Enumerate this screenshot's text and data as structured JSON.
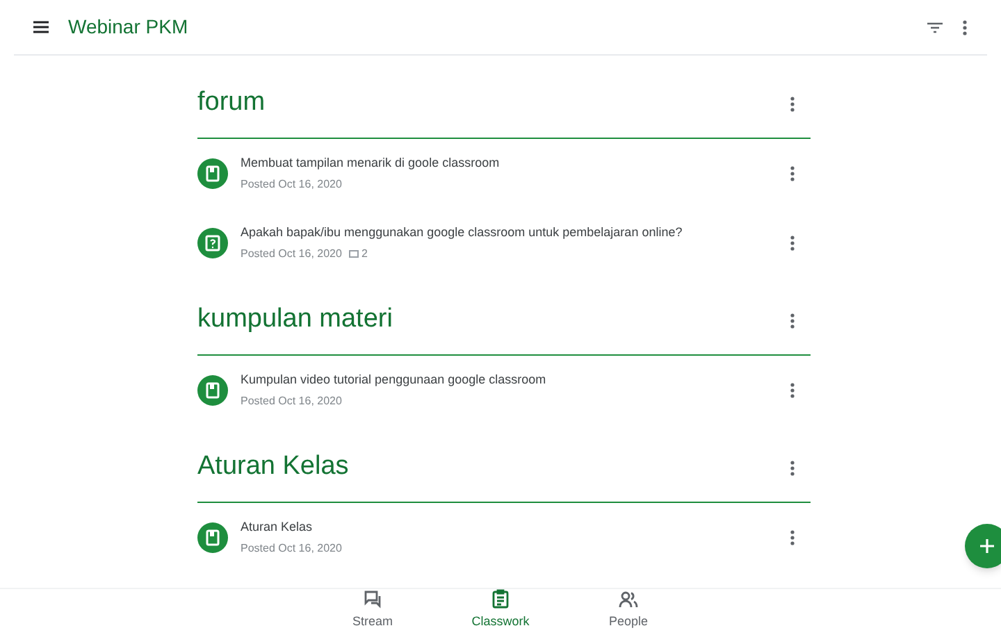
{
  "app_bar": {
    "title": "Webinar PKM"
  },
  "topics": [
    {
      "title": "forum",
      "items": [
        {
          "kind": "material",
          "title": "Membuat tampilan menarik di goole classroom",
          "posted": "Posted Oct 16, 2020"
        },
        {
          "kind": "question",
          "title": "Apakah bapak/ibu menggunakan google classroom untuk pembelajaran online?",
          "posted": "Posted Oct 16, 2020",
          "comments": "2"
        }
      ]
    },
    {
      "title": "kumpulan materi",
      "items": [
        {
          "kind": "material",
          "title": "Kumpulan video tutorial penggunaan google classroom",
          "posted": "Posted Oct 16, 2020"
        }
      ]
    },
    {
      "title": "Aturan Kelas",
      "items": [
        {
          "kind": "material",
          "title": "Aturan Kelas",
          "posted": "Posted Oct 16, 2020"
        }
      ]
    }
  ],
  "nav": [
    {
      "kind": "stream",
      "label": "Stream",
      "selected": false
    },
    {
      "kind": "classwork",
      "label": "Classwork",
      "selected": true
    },
    {
      "kind": "people",
      "label": "People",
      "selected": false
    }
  ]
}
